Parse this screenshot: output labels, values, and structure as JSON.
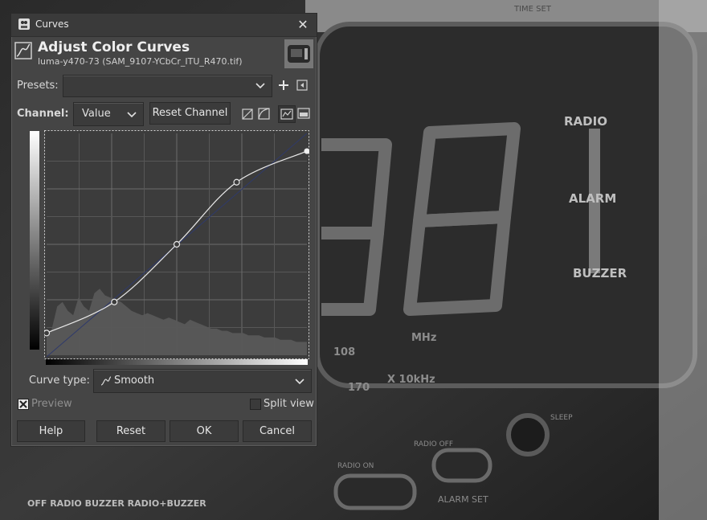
{
  "window": {
    "title": "Curves",
    "close_icon": "close-icon"
  },
  "header": {
    "title": "Adjust Color Curves",
    "subtitle": "luma-y470-73 (SAM_9107-YCbCr_ITU_R470.tif)"
  },
  "presets": {
    "label": "Presets:",
    "value": ""
  },
  "channel": {
    "label": "Channel:",
    "value": "Value",
    "reset_label": "Reset Channel"
  },
  "curve_type": {
    "label": "Curve type:",
    "value": "Smooth"
  },
  "options": {
    "preview_label": "Preview",
    "preview_checked": true,
    "split_view_label": "Split view",
    "split_view_checked": false
  },
  "buttons": {
    "help": "Help",
    "reset": "Reset",
    "ok": "OK",
    "cancel": "Cancel"
  },
  "background": {
    "radio_label": "RADIO",
    "alarm_label": "ALARM",
    "buzzer_label": "BUZZER",
    "mhz_label": "MHz",
    "khz_label": "X 10kHz",
    "freq_108": "108",
    "freq_170": "170",
    "sleep_label": "SLEEP",
    "bottom_label": "OFF  RADIO  BUZZER  RADIO+BUZZER",
    "time_set": "TIME SET",
    "alarm_set": "ALARM SET",
    "radio_on": "RADIO ON",
    "radio_off": "RADIO OFF"
  },
  "curve": {
    "points": [
      [
        0.0,
        0.1
      ],
      [
        0.26,
        0.24
      ],
      [
        0.5,
        0.5
      ],
      [
        0.73,
        0.78
      ],
      [
        1.0,
        0.92
      ]
    ],
    "grid": "4x4 quarters with eighth subdivisions"
  }
}
